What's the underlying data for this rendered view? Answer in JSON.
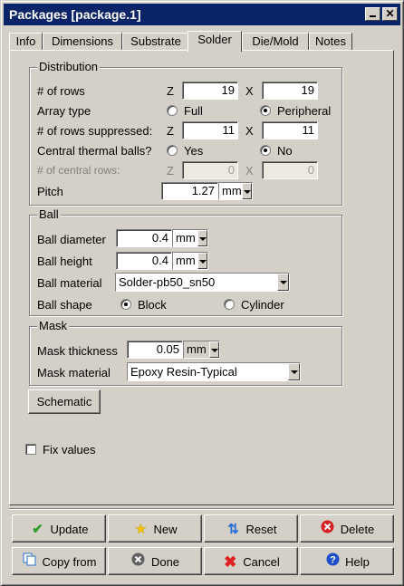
{
  "window": {
    "title": "Packages [package.1]"
  },
  "tabs": [
    "Info",
    "Dimensions",
    "Substrate",
    "Solder",
    "Die/Mold",
    "Notes"
  ],
  "distribution": {
    "group_label": "Distribution",
    "rows_label": "# of rows",
    "z_label": "Z",
    "x_label": "X",
    "rows_z": "19",
    "rows_x": "19",
    "array_type_label": "Array type",
    "array_full": "Full",
    "array_peripheral": "Peripheral",
    "suppressed_label": "# of rows suppressed:",
    "suppressed_z": "11",
    "suppressed_x": "11",
    "thermal_label": "Central thermal balls?",
    "thermal_yes": "Yes",
    "thermal_no": "No",
    "central_rows_label": "# of central rows:",
    "central_z": "0",
    "central_x": "0",
    "pitch_label": "Pitch",
    "pitch_value": "1.27",
    "pitch_unit": "mm"
  },
  "ball": {
    "group_label": "Ball",
    "diameter_label": "Ball diameter",
    "diameter_value": "0.4",
    "diameter_unit": "mm",
    "height_label": "Ball height",
    "height_value": "0.4",
    "height_unit": "mm",
    "material_label": "Ball material",
    "material_value": "Solder-pb50_sn50",
    "shape_label": "Ball shape",
    "shape_block": "Block",
    "shape_cylinder": "Cylinder"
  },
  "mask": {
    "group_label": "Mask",
    "thickness_label": "Mask thickness",
    "thickness_value": "0.05",
    "thickness_unit": "mm",
    "material_label": "Mask material",
    "material_value": "Epoxy Resin-Typical"
  },
  "schematic_label": "Schematic",
  "fix_values_label": "Fix values",
  "buttons": {
    "update": "Update",
    "new": "New",
    "reset": "Reset",
    "delete": "Delete",
    "copy_from": "Copy from",
    "done": "Done",
    "cancel": "Cancel",
    "help": "Help"
  },
  "colors": {
    "titlebar": "#0a246a",
    "face": "#d4d0c8",
    "update_icon": "#2e9e2e",
    "new_icon": "#f2c200",
    "reset_icon": "#2a6fd6",
    "delete_icon": "#d42020",
    "cancel_icon": "#e02020",
    "help_icon": "#1e4fc8"
  }
}
